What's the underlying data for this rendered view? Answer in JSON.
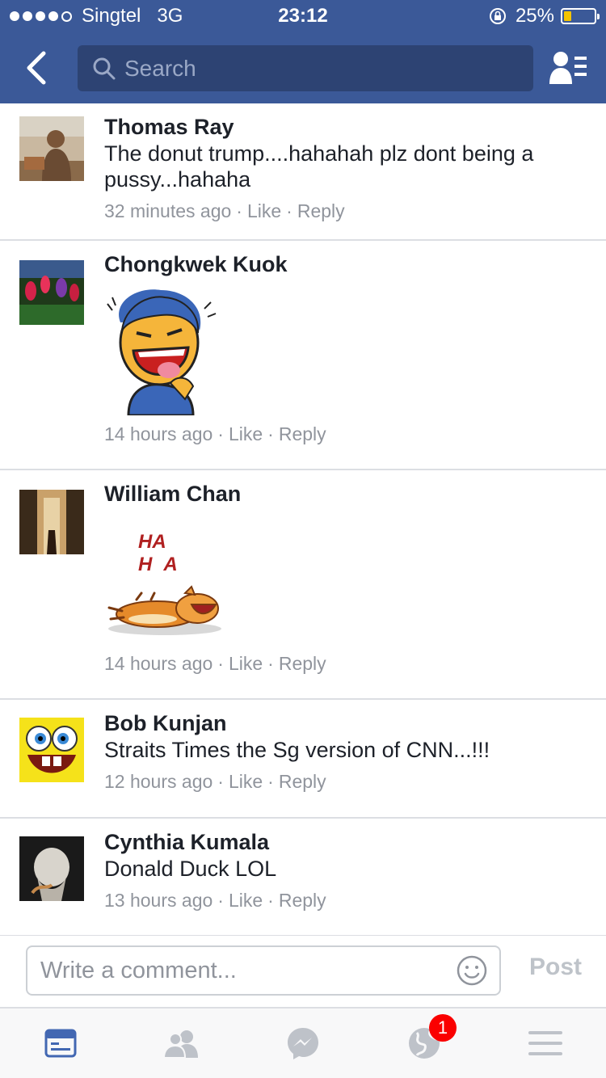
{
  "status_bar": {
    "carrier": "Singtel",
    "network": "3G",
    "time": "23:12",
    "battery": "25%",
    "battery_level": 0.25,
    "signal_bars": 4,
    "signal_total": 5
  },
  "nav": {
    "search_placeholder": "Search",
    "back_icon": "chevron-left-icon",
    "friends_icon": "friend-requests-icon"
  },
  "comments": [
    {
      "name": "Thomas Ray",
      "text": "The donut trump....hahahah plz dont being a pussy...hahaha",
      "time": "32 minutes ago",
      "like": "Like",
      "reply": "Reply"
    },
    {
      "name": "Chongkwek Kuok",
      "text": "",
      "time": "14 hours ago",
      "like": "Like",
      "reply": "Reply"
    },
    {
      "name": "William Chan",
      "sticker_text_1": "HA",
      "sticker_text_2": "HA",
      "time": "14 hours ago",
      "like": "Like",
      "reply": "Reply"
    },
    {
      "name": "Bob Kunjan",
      "text": "Straits Times the Sg version of CNN...!!!",
      "time": "12 hours ago",
      "like": "Like",
      "reply": "Reply"
    },
    {
      "name": "Cynthia Kumala",
      "text": "Donald Duck LOL",
      "time": "13 hours ago",
      "like": "Like",
      "reply": "Reply"
    }
  ],
  "composer": {
    "placeholder": "Write a comment...",
    "post_label": "Post"
  },
  "tabs": {
    "notifications_badge": "1"
  },
  "colors": {
    "brand": "#3b5998",
    "active_tab": "#4267b2",
    "inactive_tab": "#bec2c9"
  }
}
